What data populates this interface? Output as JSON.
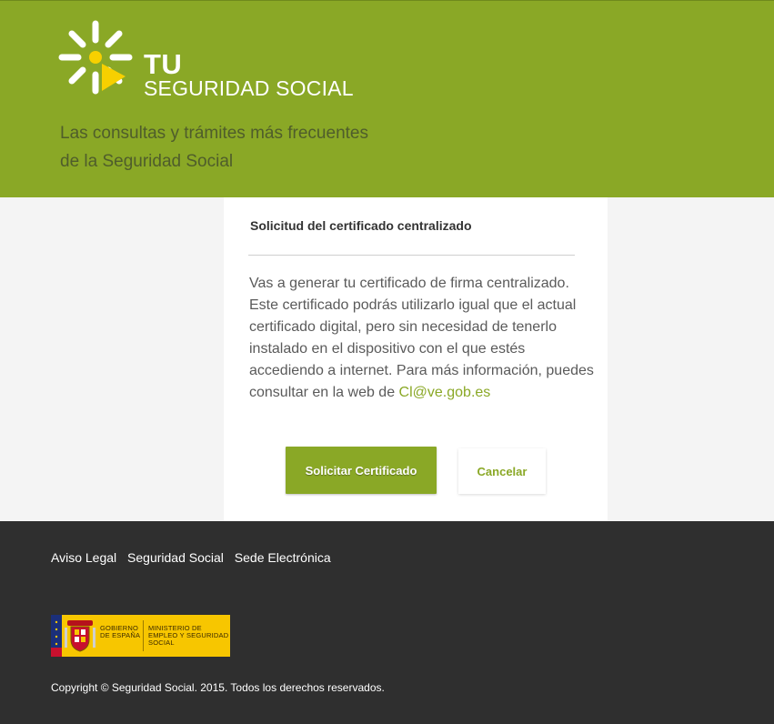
{
  "colors": {
    "brand_green": "#8aa826",
    "footer_bg": "#2f2f2f",
    "page_bg": "#f4f4f4",
    "gov_yellow": "#f7c600"
  },
  "header": {
    "brand_line1": "TU",
    "brand_line2": "SEGURIDAD SOCIAL",
    "tagline_line1": "Las consultas y trámites más frecuentes",
    "tagline_line2": "de la Seguridad Social",
    "logo_icon": "sun-play-logo-icon"
  },
  "card": {
    "title": "Solicitud del certificado centralizado",
    "body": "Vas a generar tu certificado de firma centralizado. Este certificado podrás utilizarlo igual que el actual certificado digital, pero sin necesidad de tenerlo instalado en el dispositivo con el que estés accediendo a internet. Para más información, puedes consultar en la web de ",
    "link_text": "Cl@ve.gob.es",
    "primary_button": "Solicitar Certificado",
    "secondary_button": "Cancelar"
  },
  "footer": {
    "links": [
      "Aviso Legal",
      "Seguridad Social",
      "Sede Electrónica"
    ],
    "gov_logo_text1": "GOBIERNO DE ESPAÑA",
    "gov_logo_text2": "MINISTERIO DE EMPLEO Y SEGURIDAD SOCIAL",
    "copyright": "Copyright © Seguridad Social. 2015. Todos los derechos reservados."
  }
}
